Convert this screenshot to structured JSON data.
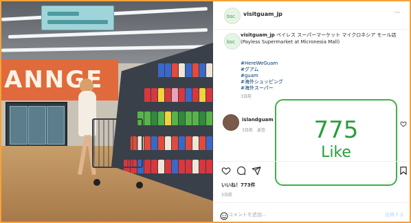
{
  "photo": {
    "wall_letters": "ANNGE"
  },
  "post": {
    "account": "visitguam_jp",
    "more_label": "···",
    "caption_text": "ペイレス スーパーマーケット マイクロネシア モール店 (Payless Supermarket at Micronesia Mall)",
    "hashtags": [
      "#HereWeGuam",
      "#グアム",
      "#guam",
      "#海外ショッピング",
      "#海外スーパー"
    ],
    "caption_time": "3日前"
  },
  "comment": {
    "user": "islandguam",
    "time": "3日前",
    "reply_label": "返信"
  },
  "actions": {
    "likes_text": "いいね！773件",
    "post_time": "3日前"
  },
  "overlay": {
    "count": "775",
    "label": "Like",
    "color": "#2a9d3a"
  },
  "add_comment": {
    "placeholder": "コメントを追加...",
    "post_label": "投稿する"
  }
}
